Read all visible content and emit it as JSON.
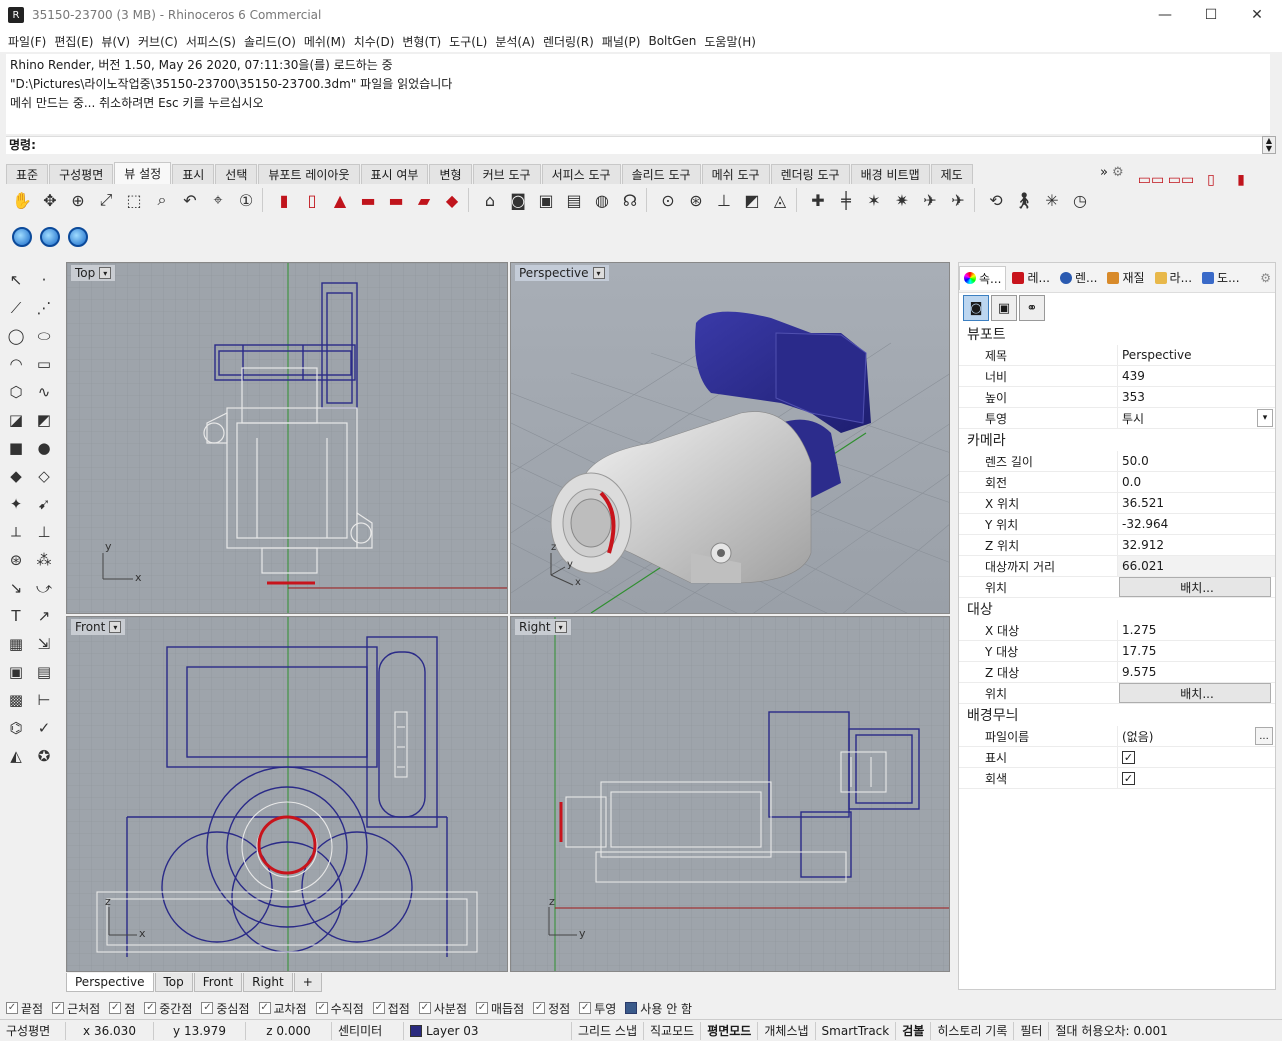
{
  "window": {
    "title": "35150-23700 (3 MB) - Rhinoceros 6 Commercial",
    "logo_glyph": "R",
    "minimize": "—",
    "maximize": "☐",
    "close": "✕"
  },
  "menu": [
    "파일(F)",
    "편집(E)",
    "뷰(V)",
    "커브(C)",
    "서피스(S)",
    "솔리드(O)",
    "메쉬(M)",
    "치수(D)",
    "변형(T)",
    "도구(L)",
    "분석(A)",
    "렌더링(R)",
    "패널(P)",
    "BoltGen",
    "도움말(H)"
  ],
  "command_history": [
    "Rhino Render, 버전 1.50, May 26 2020, 07:11:30을(를) 로드하는 중",
    "\"D:\\Pictures\\라이노작업중\\35150-23700\\35150-23700.3dm\" 파일을 읽었습니다",
    "메쉬 만드는 중... 취소하려면 Esc 키를 누르십시오"
  ],
  "command_prompt": "명령:",
  "toolbar_tabs": [
    "표준",
    "구성평면",
    "뷰 설정",
    "표시",
    "선택",
    "뷰포트 레이아웃",
    "표시 여부",
    "변형",
    "커브 도구",
    "서피스 도구",
    "솔리드 도구",
    "메쉬 도구",
    "렌더링 도구",
    "배경 비트맵",
    "제도"
  ],
  "toolbar_active_tab": "뷰 설정",
  "toolbar_overflow": "»",
  "viewports": {
    "top": {
      "label": "Top",
      "axis_x": "x",
      "axis_y": "y"
    },
    "perspective": {
      "label": "Perspective",
      "axis_x": "x",
      "axis_y": "y",
      "axis_z": "z"
    },
    "front": {
      "label": "Front",
      "axis_x": "x",
      "axis_z": "z"
    },
    "right": {
      "label": "Right",
      "axis_y": "y",
      "axis_z": "z"
    },
    "dropdown": "▾"
  },
  "viewport_tabs": [
    "Perspective",
    "Top",
    "Front",
    "Right"
  ],
  "viewport_tab_add": "+",
  "panel": {
    "tabs": [
      "속...",
      "레...",
      "렌...",
      "재질",
      "라...",
      "도..."
    ],
    "sections": {
      "viewport": "뷰포트",
      "camera": "카메라",
      "target": "대상",
      "wallpaper": "배경무늬"
    },
    "viewport_rows": [
      {
        "k": "제목",
        "v": "Perspective"
      },
      {
        "k": "너비",
        "v": "439"
      },
      {
        "k": "높이",
        "v": "353"
      },
      {
        "k": "투영",
        "v": "투시"
      }
    ],
    "camera_rows": [
      {
        "k": "렌즈 길이",
        "v": "50.0"
      },
      {
        "k": "회전",
        "v": "0.0"
      },
      {
        "k": "X 위치",
        "v": "36.521"
      },
      {
        "k": "Y 위치",
        "v": "-32.964"
      },
      {
        "k": "Z 위치",
        "v": "32.912"
      },
      {
        "k": "대상까지 거리",
        "v": "66.021"
      },
      {
        "k": "위치",
        "v": "배치..."
      }
    ],
    "target_rows": [
      {
        "k": "X 대상",
        "v": "1.275"
      },
      {
        "k": "Y 대상",
        "v": "17.75"
      },
      {
        "k": "Z 대상",
        "v": "9.575"
      },
      {
        "k": "위치",
        "v": "배치..."
      }
    ],
    "wallpaper_rows": [
      {
        "k": "파일이름",
        "v": "(없음)"
      },
      {
        "k": "표시",
        "v": "✓"
      },
      {
        "k": "회색",
        "v": "✓"
      }
    ],
    "dots": "..."
  },
  "osnaps": [
    {
      "label": "끝점",
      "checked": false
    },
    {
      "label": "근처점",
      "checked": false
    },
    {
      "label": "점",
      "checked": false
    },
    {
      "label": "중간점",
      "checked": false
    },
    {
      "label": "중심점",
      "checked": false
    },
    {
      "label": "교차점",
      "checked": false
    },
    {
      "label": "수직점",
      "checked": false
    },
    {
      "label": "접점",
      "checked": false
    },
    {
      "label": "사분점",
      "checked": false
    },
    {
      "label": "매듭점",
      "checked": false
    },
    {
      "label": "정점",
      "checked": false
    },
    {
      "label": "투영",
      "checked": false
    },
    {
      "label": "사용 안 함",
      "checked": true
    }
  ],
  "status": {
    "cplane": "구성평면",
    "x": "x 36.030",
    "y": "y 13.979",
    "z": "z 0.000",
    "units": "센티미터",
    "layer": "Layer 03",
    "grid_snap": "그리드 스냅",
    "ortho": "직교모드",
    "planar": "평면모드",
    "osnap": "개체스냅",
    "smarttrack": "SmartTrack",
    "gumball": "검볼",
    "history": "히스토리 기록",
    "filter": "필터",
    "tolerance": "절대 허용오차: 0.001"
  },
  "colors": {
    "viewport_bg": "#9ea4ab",
    "grid": "#8c9299",
    "wire_blue": "#2a2a88",
    "wire_white": "#e8e8e8",
    "axis_red": "#a01818",
    "axis_green": "#2f8f2f",
    "accent_red": "#c8141c"
  },
  "icons": {
    "hand": "✋",
    "target": "⊕",
    "zoom": "🔍",
    "camera": "📷",
    "arrow": "↖"
  }
}
